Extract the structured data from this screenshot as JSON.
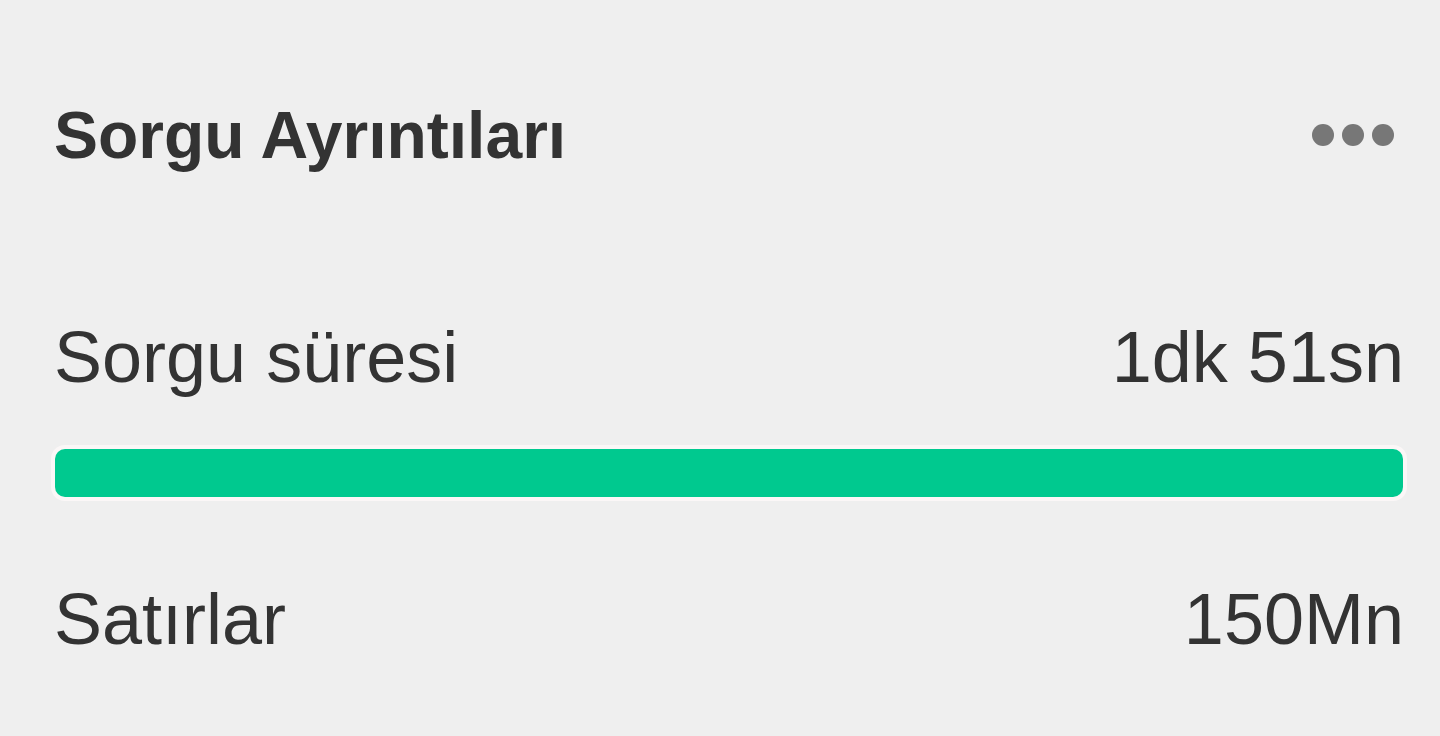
{
  "panel": {
    "title": "Sorgu Ayrıntıları"
  },
  "metrics": [
    {
      "kind": "bar",
      "label": "Sorgu süresi",
      "value": "1dk 51sn",
      "level": 1
    },
    {
      "kind": "plain",
      "label": "Satırlar",
      "value": "150Mn"
    }
  ]
}
